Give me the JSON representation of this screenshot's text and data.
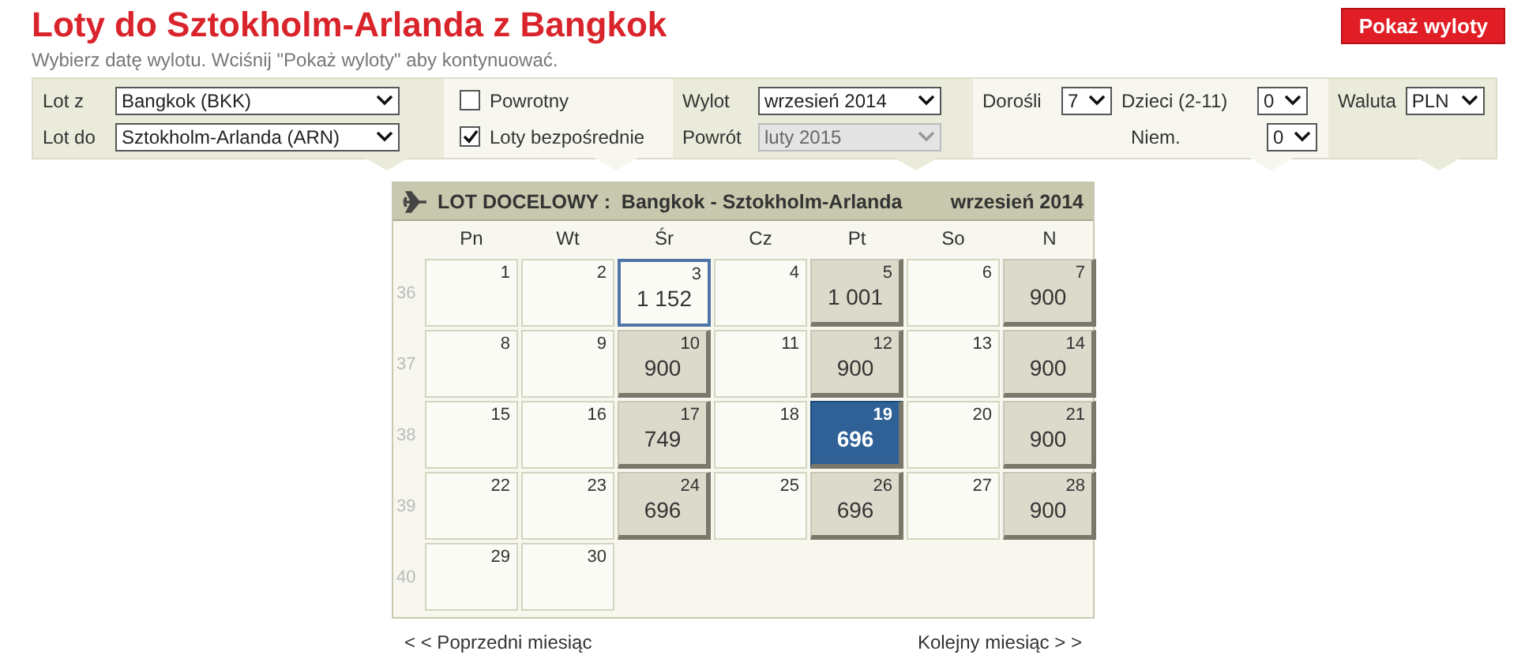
{
  "title": "Loty do Sztokholm-Arlanda z Bangkok",
  "subtitle": "Wybierz datę wylotu. Wciśnij \"Pokaż wyloty\" aby kontynuować.",
  "show_button": "Pokaż wyloty",
  "form": {
    "route": [
      {
        "label": "Lot z",
        "value": "Bangkok (BKK)",
        "disabled": false
      },
      {
        "label": "Lot do",
        "value": "Sztokholm-Arlanda (ARN)",
        "disabled": false
      }
    ],
    "options": [
      {
        "label": "Powrotny",
        "checked": false
      },
      {
        "label": "Loty bezpośrednie",
        "checked": true
      }
    ],
    "dates": [
      {
        "label": "Wylot",
        "value": "wrzesień 2014",
        "disabled": false
      },
      {
        "label": "Powrót",
        "value": "luty 2015",
        "disabled": true
      }
    ],
    "passengers": [
      {
        "label": "Dorośli",
        "value": "7",
        "disabled": false
      },
      {
        "label": "Dzieci (2-11)",
        "value": "0",
        "disabled": false
      },
      {
        "label": "Niem.",
        "value": "0",
        "disabled": false
      }
    ],
    "currency": {
      "label": "Waluta",
      "value": "PLN",
      "disabled": false
    }
  },
  "calendar": {
    "heading": "LOT DOCELOWY :  Bangkok - Sztokholm-Arlanda",
    "month": "wrzesień 2014",
    "weekdays": [
      "Pn",
      "Wt",
      "Śr",
      "Cz",
      "Pt",
      "So",
      "N"
    ],
    "weeks": [
      {
        "number": "36",
        "days": [
          {
            "day": "1",
            "kind": "plain",
            "selected": false
          },
          {
            "day": "2",
            "kind": "plain",
            "selected": false
          },
          {
            "day": "3",
            "price": "1 152",
            "kind": "outlined",
            "selected": false
          },
          {
            "day": "4",
            "kind": "plain",
            "selected": false
          },
          {
            "day": "5",
            "price": "1 001",
            "kind": "price",
            "selected": false
          },
          {
            "day": "6",
            "kind": "plain",
            "selected": false
          },
          {
            "day": "7",
            "price": "900",
            "kind": "price",
            "selected": false
          }
        ]
      },
      {
        "number": "37",
        "days": [
          {
            "day": "8",
            "kind": "plain",
            "selected": false
          },
          {
            "day": "9",
            "kind": "plain",
            "selected": false
          },
          {
            "day": "10",
            "price": "900",
            "kind": "price",
            "selected": false
          },
          {
            "day": "11",
            "kind": "plain",
            "selected": false
          },
          {
            "day": "12",
            "price": "900",
            "kind": "price",
            "selected": false
          },
          {
            "day": "13",
            "kind": "plain",
            "selected": false
          },
          {
            "day": "14",
            "price": "900",
            "kind": "price",
            "selected": false
          }
        ]
      },
      {
        "number": "38",
        "days": [
          {
            "day": "15",
            "kind": "plain",
            "selected": false
          },
          {
            "day": "16",
            "kind": "plain",
            "selected": false
          },
          {
            "day": "17",
            "price": "749",
            "kind": "price",
            "selected": false
          },
          {
            "day": "18",
            "kind": "plain",
            "selected": false
          },
          {
            "day": "19",
            "price": "696",
            "kind": "price",
            "selected": true
          },
          {
            "day": "20",
            "kind": "plain",
            "selected": false
          },
          {
            "day": "21",
            "price": "900",
            "kind": "price",
            "selected": false
          }
        ]
      },
      {
        "number": "39",
        "days": [
          {
            "day": "22",
            "kind": "plain",
            "selected": false
          },
          {
            "day": "23",
            "kind": "plain",
            "selected": false
          },
          {
            "day": "24",
            "price": "696",
            "kind": "price",
            "selected": false
          },
          {
            "day": "25",
            "kind": "plain",
            "selected": false
          },
          {
            "day": "26",
            "price": "696",
            "kind": "price",
            "selected": false
          },
          {
            "day": "27",
            "kind": "plain",
            "selected": false
          },
          {
            "day": "28",
            "price": "900",
            "kind": "price",
            "selected": false
          }
        ]
      },
      {
        "number": "40",
        "days": [
          {
            "day": "29",
            "kind": "plain",
            "selected": false
          },
          {
            "day": "30",
            "kind": "plain",
            "selected": false
          }
        ]
      }
    ],
    "prev": "< < Poprzedni miesiąc",
    "next": "Kolejny miesiąc > >"
  }
}
